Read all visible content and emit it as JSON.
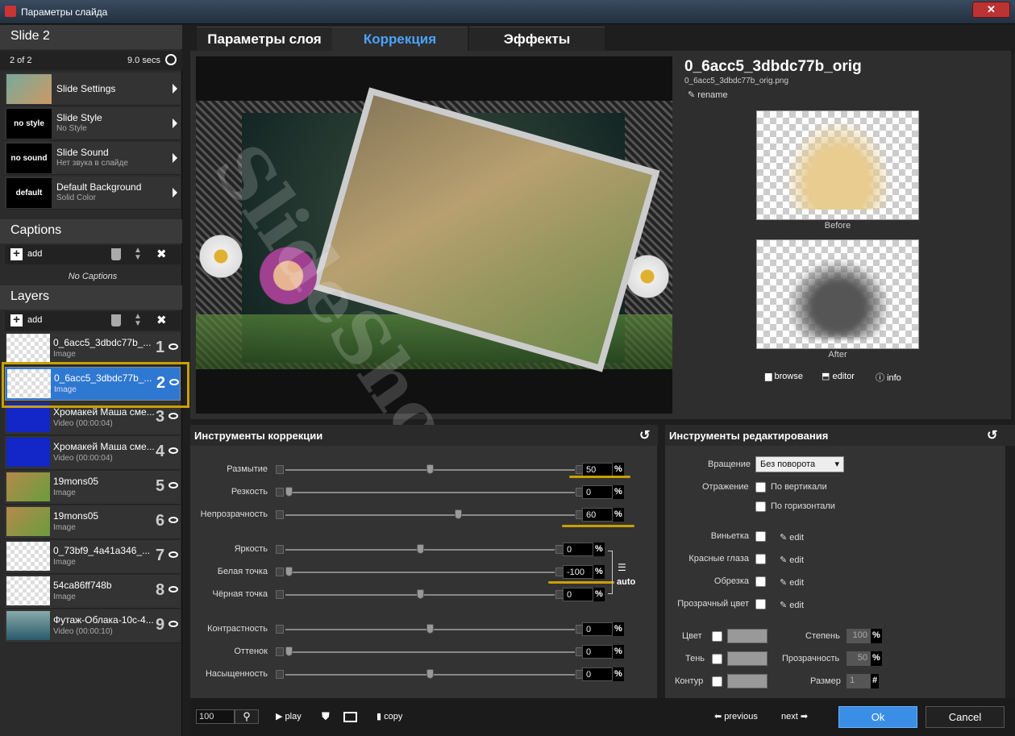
{
  "window": {
    "title": "Параметры слайда",
    "close_label": "✕"
  },
  "slide": {
    "name": "Slide 2",
    "counter": "2 of 2",
    "duration": "9.0 secs"
  },
  "slide_menu": [
    {
      "label": "Slide Settings",
      "sub": "",
      "thumb": ""
    },
    {
      "label": "Slide Style",
      "sub": "No Style",
      "thumb": "no style"
    },
    {
      "label": "Slide Sound",
      "sub": "Нет звука в слайде",
      "thumb": "no sound"
    },
    {
      "label": "Default Background",
      "sub": "Solid Color",
      "thumb": "default"
    }
  ],
  "captions": {
    "header": "Captions",
    "add_label": "add",
    "empty_text": "No Captions"
  },
  "layers": {
    "header": "Layers",
    "add_label": "add",
    "items": [
      {
        "name": "0_6acc5_3dbdc77b_...",
        "type": "Image",
        "num": "1"
      },
      {
        "name": "0_6acc5_3dbdc77b_...",
        "type": "Image",
        "num": "2"
      },
      {
        "name": "Хромакей Маша сме...",
        "type": "Video (00:00:04)",
        "num": "3"
      },
      {
        "name": "Хромакей Маша сме...",
        "type": "Video (00:00:04)",
        "num": "4"
      },
      {
        "name": "19mons05",
        "type": "Image",
        "num": "5"
      },
      {
        "name": "19mons05",
        "type": "Image",
        "num": "6"
      },
      {
        "name": "0_73bf9_4a41a346_...",
        "type": "Image",
        "num": "7"
      },
      {
        "name": "54ca86ff748b",
        "type": "Image",
        "num": "8"
      },
      {
        "name": "Футаж-Облака-10с-4...",
        "type": "Video (00:00:10)",
        "num": "9"
      }
    ]
  },
  "tabs": [
    {
      "label": "Параметры слоя"
    },
    {
      "label": "Коррекция"
    },
    {
      "label": "Эффекты"
    }
  ],
  "watermark": "SlideShow.ru",
  "file": {
    "title": "0_6acc5_3dbdc77b_orig",
    "filename": "0_6acc5_3dbdc77b_orig.png",
    "rename_label": "rename"
  },
  "preview_labels": {
    "before": "Before",
    "after": "After"
  },
  "file_actions": {
    "browse": "browse",
    "editor": "editor",
    "info": "info"
  },
  "correction": {
    "header": "Инструменты коррекции",
    "auto_label": "auto",
    "sliders": [
      {
        "label": "Размытие",
        "value": "50",
        "level": 0.5
      },
      {
        "label": "Резкость",
        "value": "0",
        "level": 0
      },
      {
        "label": "Непрозрачность",
        "value": "60",
        "level": 0.6
      },
      {
        "label": "Яркость",
        "value": "0",
        "level": 0.5
      },
      {
        "label": "Белая точка",
        "value": "-100",
        "level": 0
      },
      {
        "label": "Чёрная точка",
        "value": "0",
        "level": 0.5
      },
      {
        "label": "Контрастность",
        "value": "0",
        "level": 0.5
      },
      {
        "label": "Оттенок",
        "value": "0",
        "level": 0
      },
      {
        "label": "Насыщенность",
        "value": "0",
        "level": 0.5
      }
    ],
    "unit": "%"
  },
  "editing": {
    "header": "Инструменты редактирования",
    "rotation_label": "Вращение",
    "rotation_value": "Без поворота",
    "flip_label": "Отражение",
    "flip_vertical": "По вертикали",
    "flip_horizontal": "По горизонтали",
    "effects": [
      {
        "label": "Виньетка",
        "edit": "edit"
      },
      {
        "label": "Красные глаза",
        "edit": "edit"
      },
      {
        "label": "Обрезка",
        "edit": "edit"
      },
      {
        "label": "Прозрачный цвет",
        "edit": "edit"
      }
    ],
    "color_label": "Цвет",
    "shadow_label": "Тень",
    "outline_label": "Контур",
    "degree_label": "Степень",
    "degree_value": "100",
    "degree_unit": "%",
    "transparency_label": "Прозрачность",
    "transparency_value": "50",
    "transparency_unit": "%",
    "size_label": "Размер",
    "size_value": "1",
    "size_unit": "#"
  },
  "bottom": {
    "zoom": "100",
    "play": "play",
    "copy": "copy",
    "previous": "previous",
    "next": "next",
    "ok": "Ok",
    "cancel": "Cancel"
  },
  "colors": {
    "accent": "#2f78d2",
    "highlight": "#c9a000",
    "ok_button": "#3a8ee6"
  }
}
